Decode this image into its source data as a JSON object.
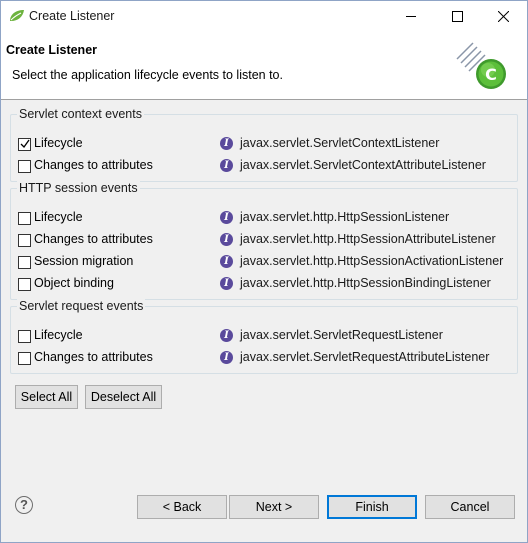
{
  "window": {
    "title": "Create Listener",
    "app_icon": "spring-leaf-icon",
    "controls": {
      "minimize": "minimize-icon",
      "maximize": "maximize-icon",
      "close": "close-icon"
    }
  },
  "header": {
    "title": "Create Listener",
    "description": "Select the application lifecycle events to listen to.",
    "graphic_icon": "wizard-class-icon",
    "graphic_letter": "C"
  },
  "groups": [
    {
      "title": "Servlet context events",
      "items": [
        {
          "label": "Lifecycle",
          "checked": true,
          "interface": "javax.servlet.ServletContextListener"
        },
        {
          "label": "Changes to attributes",
          "checked": false,
          "interface": "javax.servlet.ServletContextAttributeListener"
        }
      ]
    },
    {
      "title": "HTTP session events",
      "items": [
        {
          "label": "Lifecycle",
          "checked": false,
          "interface": "javax.servlet.http.HttpSessionListener"
        },
        {
          "label": "Changes to attributes",
          "checked": false,
          "interface": "javax.servlet.http.HttpSessionAttributeListener"
        },
        {
          "label": "Session migration",
          "checked": false,
          "interface": "javax.servlet.http.HttpSessionActivationListener"
        },
        {
          "label": "Object binding",
          "checked": false,
          "interface": "javax.servlet.http.HttpSessionBindingListener"
        }
      ]
    },
    {
      "title": "Servlet request events",
      "items": [
        {
          "label": "Lifecycle",
          "checked": false,
          "interface": "javax.servlet.ServletRequestListener"
        },
        {
          "label": "Changes to attributes",
          "checked": false,
          "interface": "javax.servlet.ServletRequestAttributeListener"
        }
      ]
    }
  ],
  "interface_icon_letter": "I",
  "selection_buttons": {
    "select_all": "Select All",
    "deselect_all": "Deselect All"
  },
  "footer": {
    "help_icon": "help-icon",
    "help_glyph": "?",
    "back": "< Back",
    "next": "Next >",
    "finish": "Finish",
    "cancel": "Cancel"
  },
  "colors": {
    "accent": "#0078d7",
    "interface_icon": "#5a4a9c",
    "spring_green": "#6db33f"
  }
}
